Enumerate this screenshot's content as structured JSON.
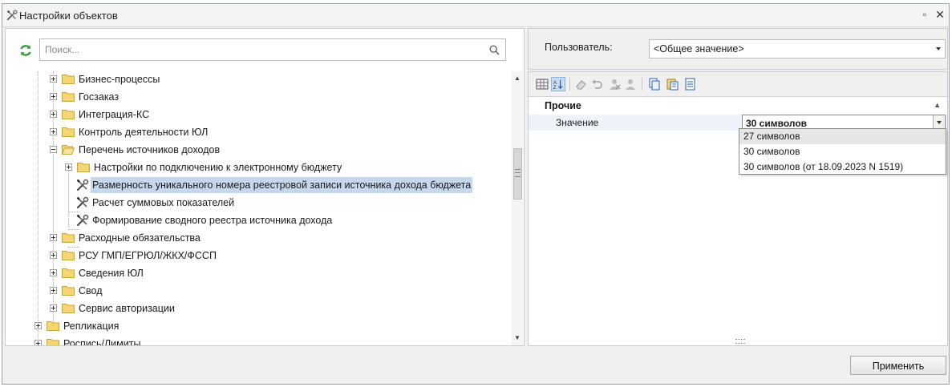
{
  "window": {
    "title": "Настройки объектов",
    "restore_glyph": "▫",
    "close_glyph": "✕"
  },
  "search": {
    "placeholder": "Поиск..."
  },
  "tree": {
    "items": [
      {
        "label": "Бизнес-процессы",
        "type": "folder",
        "expander": "plus"
      },
      {
        "label": "Госзаказ",
        "type": "folder",
        "expander": "plus"
      },
      {
        "label": "Интеграция-КС",
        "type": "folder",
        "expander": "plus"
      },
      {
        "label": "Контроль деятельности ЮЛ",
        "type": "folder",
        "expander": "plus"
      },
      {
        "label": "Перечень источников доходов",
        "type": "folder-open",
        "expander": "minus"
      },
      {
        "label": "Настройки по подключению к электронному бюджету",
        "type": "folder",
        "expander": "plus"
      },
      {
        "label": "Размерность уникального номера реестровой записи источника дохода бюджета",
        "type": "setting",
        "selected": true
      },
      {
        "label": "Расчет суммовых показателей",
        "type": "setting"
      },
      {
        "label": "Формирование сводного реестра источника дохода",
        "type": "setting"
      },
      {
        "label": "Расходные обязательства",
        "type": "folder",
        "expander": "plus"
      },
      {
        "label": "РСУ ГМП/ЕГРЮЛ/ЖКХ/ФССП",
        "type": "folder",
        "expander": "plus"
      },
      {
        "label": "Сведения ЮЛ",
        "type": "folder",
        "expander": "plus"
      },
      {
        "label": "Свод",
        "type": "folder",
        "expander": "plus"
      },
      {
        "label": "Сервис авторизации",
        "type": "folder",
        "expander": "plus"
      },
      {
        "label": "Репликация",
        "type": "folder",
        "expander": "plus"
      },
      {
        "label": "Роспись/Лимиты",
        "type": "folder",
        "expander": "plus"
      }
    ]
  },
  "user": {
    "label": "Пользователь:",
    "value": "<Общее значение>"
  },
  "properties": {
    "category": "Прочие",
    "row_name": "Значение",
    "row_value": "30 символов",
    "options": [
      "27 символов",
      "30 символов",
      "30 символов (от 18.09.2023 N 1519)"
    ],
    "hovered_option_index": 0
  },
  "toolbar": {
    "icons": [
      "categorized-view-icon",
      "alphabetical-sort-icon",
      "eraser-icon",
      "undo-icon",
      "delete-user-icon",
      "user-icon",
      "copy-icon",
      "paste-icon",
      "report-icon"
    ]
  },
  "footer": {
    "apply_label": "Применить"
  },
  "colors": {
    "selection": "#c5d7ec",
    "folder": "#f5d673",
    "accent_green": "#3a9b3a"
  }
}
